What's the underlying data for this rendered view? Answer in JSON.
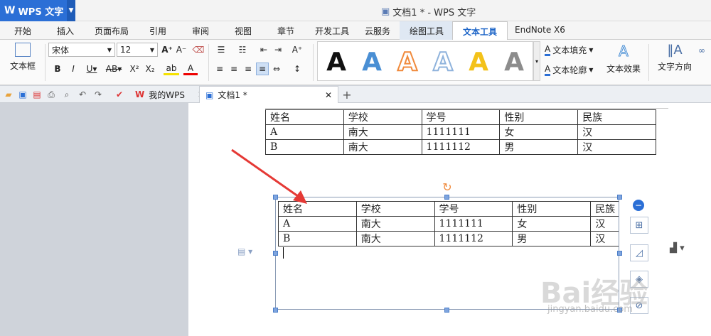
{
  "app": {
    "name": "WPS 文字",
    "window_title": "文档1 * - WPS 文字"
  },
  "menu": {
    "items": [
      "开始",
      "插入",
      "页面布局",
      "引用",
      "审阅",
      "视图",
      "章节",
      "开发工具",
      "云服务"
    ],
    "tool_tab": "绘图工具",
    "active_tab": "文本工具",
    "extra_tab": "EndNote X6"
  },
  "ribbon": {
    "textbox_label": "文本框",
    "font_name": "宋体",
    "font_size": "12",
    "text_fill": "文本填充",
    "text_outline": "文本轮廓",
    "text_effect": "文本效果",
    "text_direction": "文字方向",
    "art_styles": [
      {
        "letter": "A",
        "color": "#111111"
      },
      {
        "letter": "A",
        "color": "#4a8fd4"
      },
      {
        "letter": "A",
        "color": "#f08a3c"
      },
      {
        "letter": "A",
        "color": "#8fb3dc"
      },
      {
        "letter": "A",
        "color": "#f3c21a"
      },
      {
        "letter": "A",
        "color": "#8c8c8c"
      }
    ]
  },
  "tabs": {
    "home": "我的WPS",
    "doc": "文档1 *",
    "add": "+"
  },
  "table": {
    "headers": [
      "姓名",
      "学校",
      "学号",
      "性别",
      "民族"
    ],
    "rows": [
      [
        "A",
        "南大",
        "1111111",
        "女",
        "汉"
      ],
      [
        "B",
        "南大",
        "1111112",
        "男",
        "汉"
      ]
    ]
  },
  "watermark": {
    "brand": "Bai经验",
    "url": "jingyan.baidu.com"
  },
  "colors": {
    "brand_blue": "#2b6fd6",
    "arrow_red": "#e53935",
    "handle_blue": "#7ea4de"
  }
}
